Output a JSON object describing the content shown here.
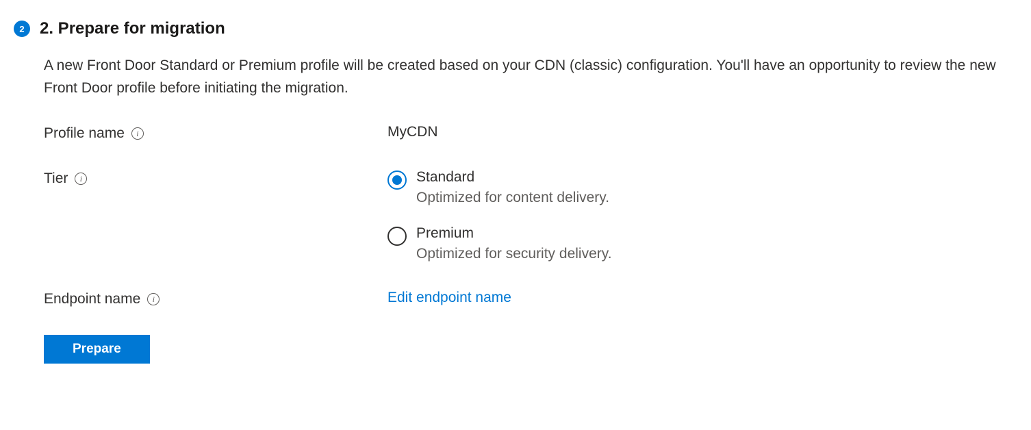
{
  "step": {
    "number": "2",
    "title": "2. Prepare for migration",
    "description": "A new Front Door Standard or Premium profile will be created based on your CDN (classic) configuration. You'll have an opportunity to review the new Front Door profile before initiating the migration."
  },
  "form": {
    "profile_name": {
      "label": "Profile name",
      "value": "MyCDN"
    },
    "tier": {
      "label": "Tier",
      "options": [
        {
          "label": "Standard",
          "description": "Optimized for content delivery.",
          "selected": true
        },
        {
          "label": "Premium",
          "description": "Optimized for security delivery.",
          "selected": false
        }
      ]
    },
    "endpoint_name": {
      "label": "Endpoint name",
      "link_text": "Edit endpoint name"
    }
  },
  "buttons": {
    "prepare": "Prepare"
  }
}
